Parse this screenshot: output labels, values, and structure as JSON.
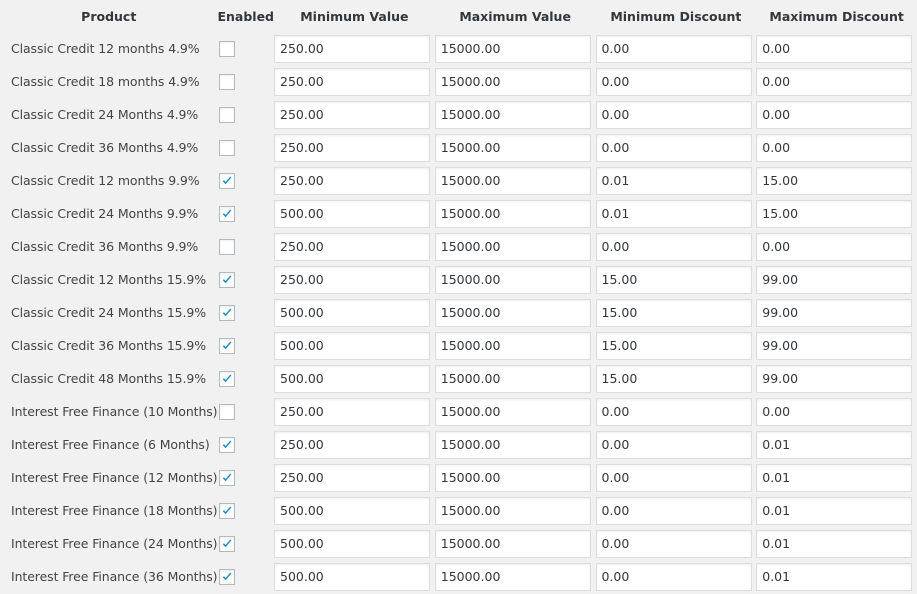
{
  "headers": {
    "product": "Product",
    "enabled": "Enabled",
    "min_value": "Minimum Value",
    "max_value": "Maximum Value",
    "min_discount": "Minimum Discount",
    "max_discount": "Maximum Discount"
  },
  "check_color": "#1e8cbe",
  "rows": [
    {
      "product": "Classic Credit 12 months 4.9%",
      "enabled": false,
      "min_value": "250.00",
      "max_value": "15000.00",
      "min_discount": "0.00",
      "max_discount": "0.00"
    },
    {
      "product": "Classic Credit 18 months 4.9%",
      "enabled": false,
      "min_value": "250.00",
      "max_value": "15000.00",
      "min_discount": "0.00",
      "max_discount": "0.00"
    },
    {
      "product": "Classic Credit 24 Months 4.9%",
      "enabled": false,
      "min_value": "250.00",
      "max_value": "15000.00",
      "min_discount": "0.00",
      "max_discount": "0.00"
    },
    {
      "product": "Classic Credit 36 Months 4.9%",
      "enabled": false,
      "min_value": "250.00",
      "max_value": "15000.00",
      "min_discount": "0.00",
      "max_discount": "0.00"
    },
    {
      "product": "Classic Credit 12 months 9.9%",
      "enabled": true,
      "min_value": "250.00",
      "max_value": "15000.00",
      "min_discount": "0.01",
      "max_discount": "15.00"
    },
    {
      "product": "Classic Credit 24 Months 9.9%",
      "enabled": true,
      "min_value": "500.00",
      "max_value": "15000.00",
      "min_discount": "0.01",
      "max_discount": "15.00"
    },
    {
      "product": "Classic Credit 36 Months 9.9%",
      "enabled": false,
      "min_value": "250.00",
      "max_value": "15000.00",
      "min_discount": "0.00",
      "max_discount": "0.00"
    },
    {
      "product": "Classic Credit 12 Months 15.9%",
      "enabled": true,
      "min_value": "250.00",
      "max_value": "15000.00",
      "min_discount": "15.00",
      "max_discount": "99.00"
    },
    {
      "product": "Classic Credit 24 Months 15.9%",
      "enabled": true,
      "min_value": "500.00",
      "max_value": "15000.00",
      "min_discount": "15.00",
      "max_discount": "99.00"
    },
    {
      "product": "Classic Credit 36 Months 15.9%",
      "enabled": true,
      "min_value": "500.00",
      "max_value": "15000.00",
      "min_discount": "15.00",
      "max_discount": "99.00"
    },
    {
      "product": "Classic Credit 48 Months 15.9%",
      "enabled": true,
      "min_value": "500.00",
      "max_value": "15000.00",
      "min_discount": "15.00",
      "max_discount": "99.00"
    },
    {
      "product": "Interest Free Finance (10 Months)",
      "enabled": false,
      "min_value": "250.00",
      "max_value": "15000.00",
      "min_discount": "0.00",
      "max_discount": "0.00"
    },
    {
      "product": "Interest Free Finance (6 Months)",
      "enabled": true,
      "min_value": "250.00",
      "max_value": "15000.00",
      "min_discount": "0.00",
      "max_discount": "0.01"
    },
    {
      "product": "Interest Free Finance (12 Months)",
      "enabled": true,
      "min_value": "250.00",
      "max_value": "15000.00",
      "min_discount": "0.00",
      "max_discount": "0.01"
    },
    {
      "product": "Interest Free Finance (18 Months)",
      "enabled": true,
      "min_value": "500.00",
      "max_value": "15000.00",
      "min_discount": "0.00",
      "max_discount": "0.01"
    },
    {
      "product": "Interest Free Finance (24 Months)",
      "enabled": true,
      "min_value": "500.00",
      "max_value": "15000.00",
      "min_discount": "0.00",
      "max_discount": "0.01"
    },
    {
      "product": "Interest Free Finance (36 Months)",
      "enabled": true,
      "min_value": "500.00",
      "max_value": "15000.00",
      "min_discount": "0.00",
      "max_discount": "0.01"
    }
  ]
}
